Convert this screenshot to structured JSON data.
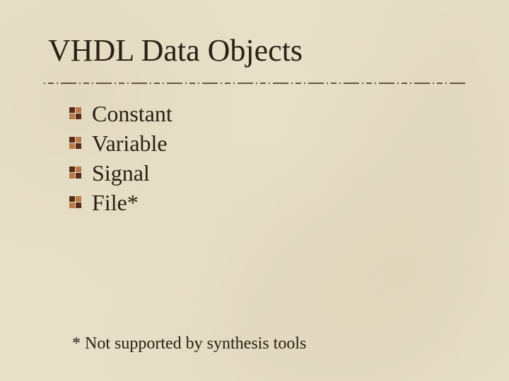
{
  "title": "VHDL Data Objects",
  "bullets": [
    {
      "text": "Constant"
    },
    {
      "text": "Variable"
    },
    {
      "text": "Signal"
    },
    {
      "text": "File*"
    }
  ],
  "footnote": "*  Not supported by synthesis tools",
  "colors": {
    "background": "#e8e0c8",
    "text": "#2a2015",
    "accent_dark": "#5a2c18",
    "accent_light": "#c08040"
  }
}
